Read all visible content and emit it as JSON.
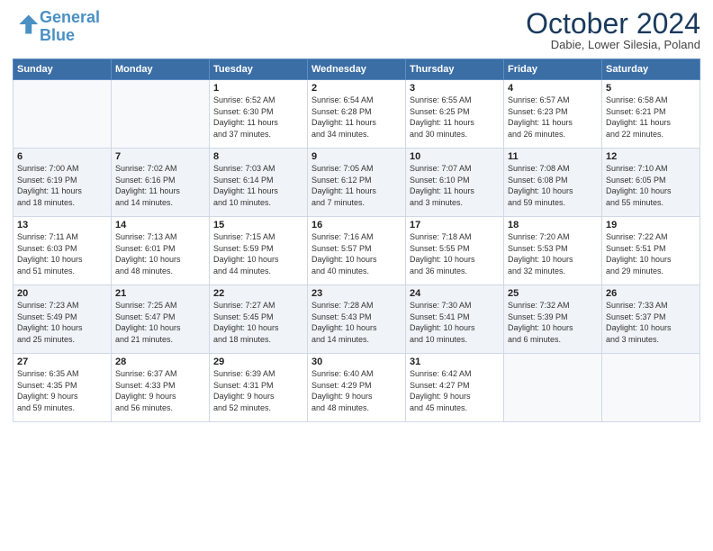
{
  "header": {
    "logo_line1": "General",
    "logo_line2": "Blue",
    "month": "October 2024",
    "location": "Dabie, Lower Silesia, Poland"
  },
  "days_of_week": [
    "Sunday",
    "Monday",
    "Tuesday",
    "Wednesday",
    "Thursday",
    "Friday",
    "Saturday"
  ],
  "weeks": [
    [
      {
        "day": "",
        "info": ""
      },
      {
        "day": "",
        "info": ""
      },
      {
        "day": "1",
        "info": "Sunrise: 6:52 AM\nSunset: 6:30 PM\nDaylight: 11 hours\nand 37 minutes."
      },
      {
        "day": "2",
        "info": "Sunrise: 6:54 AM\nSunset: 6:28 PM\nDaylight: 11 hours\nand 34 minutes."
      },
      {
        "day": "3",
        "info": "Sunrise: 6:55 AM\nSunset: 6:25 PM\nDaylight: 11 hours\nand 30 minutes."
      },
      {
        "day": "4",
        "info": "Sunrise: 6:57 AM\nSunset: 6:23 PM\nDaylight: 11 hours\nand 26 minutes."
      },
      {
        "day": "5",
        "info": "Sunrise: 6:58 AM\nSunset: 6:21 PM\nDaylight: 11 hours\nand 22 minutes."
      }
    ],
    [
      {
        "day": "6",
        "info": "Sunrise: 7:00 AM\nSunset: 6:19 PM\nDaylight: 11 hours\nand 18 minutes."
      },
      {
        "day": "7",
        "info": "Sunrise: 7:02 AM\nSunset: 6:16 PM\nDaylight: 11 hours\nand 14 minutes."
      },
      {
        "day": "8",
        "info": "Sunrise: 7:03 AM\nSunset: 6:14 PM\nDaylight: 11 hours\nand 10 minutes."
      },
      {
        "day": "9",
        "info": "Sunrise: 7:05 AM\nSunset: 6:12 PM\nDaylight: 11 hours\nand 7 minutes."
      },
      {
        "day": "10",
        "info": "Sunrise: 7:07 AM\nSunset: 6:10 PM\nDaylight: 11 hours\nand 3 minutes."
      },
      {
        "day": "11",
        "info": "Sunrise: 7:08 AM\nSunset: 6:08 PM\nDaylight: 10 hours\nand 59 minutes."
      },
      {
        "day": "12",
        "info": "Sunrise: 7:10 AM\nSunset: 6:05 PM\nDaylight: 10 hours\nand 55 minutes."
      }
    ],
    [
      {
        "day": "13",
        "info": "Sunrise: 7:11 AM\nSunset: 6:03 PM\nDaylight: 10 hours\nand 51 minutes."
      },
      {
        "day": "14",
        "info": "Sunrise: 7:13 AM\nSunset: 6:01 PM\nDaylight: 10 hours\nand 48 minutes."
      },
      {
        "day": "15",
        "info": "Sunrise: 7:15 AM\nSunset: 5:59 PM\nDaylight: 10 hours\nand 44 minutes."
      },
      {
        "day": "16",
        "info": "Sunrise: 7:16 AM\nSunset: 5:57 PM\nDaylight: 10 hours\nand 40 minutes."
      },
      {
        "day": "17",
        "info": "Sunrise: 7:18 AM\nSunset: 5:55 PM\nDaylight: 10 hours\nand 36 minutes."
      },
      {
        "day": "18",
        "info": "Sunrise: 7:20 AM\nSunset: 5:53 PM\nDaylight: 10 hours\nand 32 minutes."
      },
      {
        "day": "19",
        "info": "Sunrise: 7:22 AM\nSunset: 5:51 PM\nDaylight: 10 hours\nand 29 minutes."
      }
    ],
    [
      {
        "day": "20",
        "info": "Sunrise: 7:23 AM\nSunset: 5:49 PM\nDaylight: 10 hours\nand 25 minutes."
      },
      {
        "day": "21",
        "info": "Sunrise: 7:25 AM\nSunset: 5:47 PM\nDaylight: 10 hours\nand 21 minutes."
      },
      {
        "day": "22",
        "info": "Sunrise: 7:27 AM\nSunset: 5:45 PM\nDaylight: 10 hours\nand 18 minutes."
      },
      {
        "day": "23",
        "info": "Sunrise: 7:28 AM\nSunset: 5:43 PM\nDaylight: 10 hours\nand 14 minutes."
      },
      {
        "day": "24",
        "info": "Sunrise: 7:30 AM\nSunset: 5:41 PM\nDaylight: 10 hours\nand 10 minutes."
      },
      {
        "day": "25",
        "info": "Sunrise: 7:32 AM\nSunset: 5:39 PM\nDaylight: 10 hours\nand 6 minutes."
      },
      {
        "day": "26",
        "info": "Sunrise: 7:33 AM\nSunset: 5:37 PM\nDaylight: 10 hours\nand 3 minutes."
      }
    ],
    [
      {
        "day": "27",
        "info": "Sunrise: 6:35 AM\nSunset: 4:35 PM\nDaylight: 9 hours\nand 59 minutes."
      },
      {
        "day": "28",
        "info": "Sunrise: 6:37 AM\nSunset: 4:33 PM\nDaylight: 9 hours\nand 56 minutes."
      },
      {
        "day": "29",
        "info": "Sunrise: 6:39 AM\nSunset: 4:31 PM\nDaylight: 9 hours\nand 52 minutes."
      },
      {
        "day": "30",
        "info": "Sunrise: 6:40 AM\nSunset: 4:29 PM\nDaylight: 9 hours\nand 48 minutes."
      },
      {
        "day": "31",
        "info": "Sunrise: 6:42 AM\nSunset: 4:27 PM\nDaylight: 9 hours\nand 45 minutes."
      },
      {
        "day": "",
        "info": ""
      },
      {
        "day": "",
        "info": ""
      }
    ]
  ]
}
